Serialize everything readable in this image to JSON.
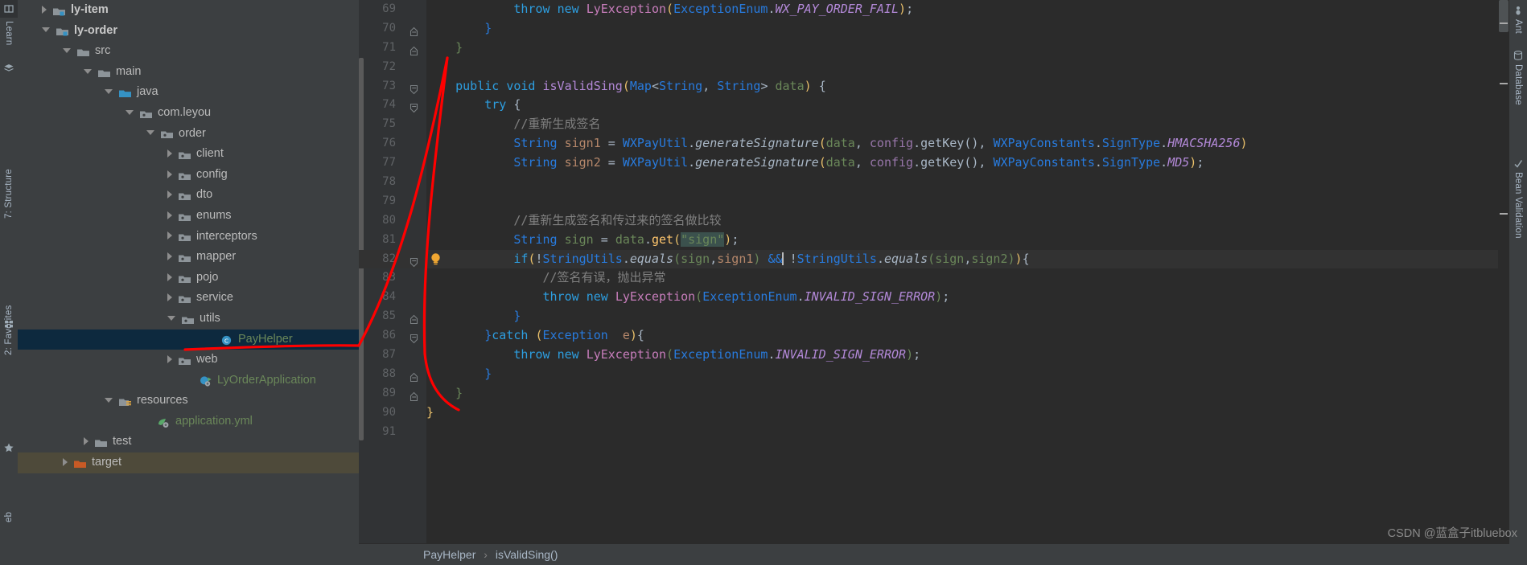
{
  "app": {
    "theme_bg": "#3c3f41",
    "editor_bg": "#2b2b2b",
    "selection_bg": "#0d293e",
    "annotation_color": "#ff0000"
  },
  "left_stripe": {
    "items": [
      {
        "label": "Learn",
        "icon": "learn-icon"
      },
      {
        "label": "7: Structure",
        "icon": "structure-icon"
      },
      {
        "label": "2: Favorites",
        "icon": "favorites-star-icon"
      }
    ]
  },
  "right_stripe": {
    "items": [
      {
        "label": "Ant",
        "icon": "ant-icon"
      },
      {
        "label": "Database",
        "icon": "database-icon"
      },
      {
        "label": "Bean Validation",
        "icon": "bean-validation-icon"
      }
    ]
  },
  "project_tree": {
    "rows": [
      {
        "label": "ly-item",
        "indent": 1,
        "arrow": "closed",
        "icon": "module-folder-icon",
        "style": "module"
      },
      {
        "label": "ly-order",
        "indent": 1,
        "arrow": "open",
        "icon": "module-folder-icon",
        "style": "module"
      },
      {
        "label": "src",
        "indent": 2,
        "arrow": "open",
        "icon": "folder-icon",
        "style": "normal"
      },
      {
        "label": "main",
        "indent": 3,
        "arrow": "open",
        "icon": "folder-icon",
        "style": "normal"
      },
      {
        "label": "java",
        "indent": 4,
        "arrow": "open",
        "icon": "source-folder-icon",
        "style": "normal"
      },
      {
        "label": "com.leyou",
        "indent": 5,
        "arrow": "open",
        "icon": "package-icon",
        "style": "normal"
      },
      {
        "label": "order",
        "indent": 6,
        "arrow": "open",
        "icon": "package-icon",
        "style": "normal"
      },
      {
        "label": "client",
        "indent": 7,
        "arrow": "closed",
        "icon": "package-icon",
        "style": "normal"
      },
      {
        "label": "config",
        "indent": 7,
        "arrow": "closed",
        "icon": "package-icon",
        "style": "normal"
      },
      {
        "label": "dto",
        "indent": 7,
        "arrow": "closed",
        "icon": "package-icon",
        "style": "normal"
      },
      {
        "label": "enums",
        "indent": 7,
        "arrow": "closed",
        "icon": "package-icon",
        "style": "normal"
      },
      {
        "label": "interceptors",
        "indent": 7,
        "arrow": "closed",
        "icon": "package-icon",
        "style": "normal"
      },
      {
        "label": "mapper",
        "indent": 7,
        "arrow": "closed",
        "icon": "package-icon",
        "style": "normal"
      },
      {
        "label": "pojo",
        "indent": 7,
        "arrow": "closed",
        "icon": "package-icon",
        "style": "normal"
      },
      {
        "label": "service",
        "indent": 7,
        "arrow": "closed",
        "icon": "package-icon",
        "style": "normal"
      },
      {
        "label": "utils",
        "indent": 7,
        "arrow": "open",
        "icon": "package-icon",
        "style": "normal"
      },
      {
        "label": "PayHelper",
        "indent": 9,
        "arrow": "none",
        "icon": "java-class-icon",
        "style": "green",
        "selected": true
      },
      {
        "label": "web",
        "indent": 7,
        "arrow": "closed",
        "icon": "package-icon",
        "style": "normal"
      },
      {
        "label": "LyOrderApplication",
        "indent": 8,
        "arrow": "none",
        "icon": "spring-class-icon",
        "style": "green"
      },
      {
        "label": "resources",
        "indent": 4,
        "arrow": "open",
        "icon": "resources-folder-icon",
        "style": "normal"
      },
      {
        "label": "application.yml",
        "indent": 6,
        "arrow": "none",
        "icon": "spring-yml-icon",
        "style": "green"
      },
      {
        "label": "test",
        "indent": 3,
        "arrow": "closed",
        "icon": "folder-icon",
        "style": "normal"
      },
      {
        "label": "target",
        "indent": 2,
        "arrow": "closed",
        "icon": "excluded-folder-icon",
        "style": "normal",
        "excluded": true
      }
    ]
  },
  "editor": {
    "first_line_number": 69,
    "current_line": 82,
    "lines": [
      {
        "n": 69,
        "fold": "none",
        "tokens": [
          {
            "t": "            ",
            "c": "plain"
          },
          {
            "t": "throw",
            "c": "kwb"
          },
          {
            "t": " ",
            "c": "plain"
          },
          {
            "t": "new",
            "c": "kwb"
          },
          {
            "t": " ",
            "c": "plain"
          },
          {
            "t": "LyException",
            "c": "magenta"
          },
          {
            "t": "(",
            "c": "br1"
          },
          {
            "t": "ExceptionEnum",
            "c": "blu"
          },
          {
            "t": ".",
            "c": "plain"
          },
          {
            "t": "WX_PAY_ORDER_FAIL",
            "c": "stat"
          },
          {
            "t": ")",
            "c": "br1"
          },
          {
            "t": ";",
            "c": "plain"
          }
        ]
      },
      {
        "n": 70,
        "fold": "end",
        "tokens": [
          {
            "t": "        ",
            "c": "plain"
          },
          {
            "t": "}",
            "c": "blu"
          }
        ]
      },
      {
        "n": 71,
        "fold": "end",
        "tokens": [
          {
            "t": "    ",
            "c": "plain"
          },
          {
            "t": "}",
            "c": "grn"
          }
        ]
      },
      {
        "n": 72,
        "fold": "none",
        "tokens": []
      },
      {
        "n": 73,
        "fold": "start",
        "tokens": [
          {
            "t": "    ",
            "c": "plain"
          },
          {
            "t": "public",
            "c": "kwb"
          },
          {
            "t": " ",
            "c": "plain"
          },
          {
            "t": "void",
            "c": "kwb"
          },
          {
            "t": " ",
            "c": "plain"
          },
          {
            "t": "isValidSing",
            "c": "mthdecl"
          },
          {
            "t": "(",
            "c": "br1"
          },
          {
            "t": "Map",
            "c": "blu"
          },
          {
            "t": "<",
            "c": "plain"
          },
          {
            "t": "String",
            "c": "blu"
          },
          {
            "t": ", ",
            "c": "plain"
          },
          {
            "t": "String",
            "c": "blu"
          },
          {
            "t": "> ",
            "c": "plain"
          },
          {
            "t": "data",
            "c": "grn"
          },
          {
            "t": ")",
            "c": "br1"
          },
          {
            "t": " ",
            "c": "plain"
          },
          {
            "t": "{",
            "c": "plain"
          }
        ]
      },
      {
        "n": 74,
        "fold": "start",
        "tokens": [
          {
            "t": "        ",
            "c": "plain"
          },
          {
            "t": "try",
            "c": "kwb"
          },
          {
            "t": " ",
            "c": "plain"
          },
          {
            "t": "{",
            "c": "plain"
          }
        ]
      },
      {
        "n": 75,
        "fold": "none",
        "tokens": [
          {
            "t": "            ",
            "c": "plain"
          },
          {
            "t": "//重新生成签名",
            "c": "cmt"
          }
        ]
      },
      {
        "n": 76,
        "fold": "none",
        "tokens": [
          {
            "t": "            ",
            "c": "plain"
          },
          {
            "t": "String",
            "c": "blu"
          },
          {
            "t": " ",
            "c": "plain"
          },
          {
            "t": "sign1",
            "c": "param"
          },
          {
            "t": " ",
            "c": "plain"
          },
          {
            "t": "=",
            "c": "plain"
          },
          {
            "t": " ",
            "c": "plain"
          },
          {
            "t": "WXPayUtil",
            "c": "blu"
          },
          {
            "t": ".",
            "c": "plain"
          },
          {
            "t": "generateSignature",
            "c": "statm"
          },
          {
            "t": "(",
            "c": "br1"
          },
          {
            "t": "data",
            "c": "grn"
          },
          {
            "t": ", ",
            "c": "plain"
          },
          {
            "t": "config",
            "c": "field"
          },
          {
            "t": ".",
            "c": "plain"
          },
          {
            "t": "getKey",
            "c": "plain"
          },
          {
            "t": "()",
            "c": "plain"
          },
          {
            "t": ", ",
            "c": "plain"
          },
          {
            "t": "WXPayConstants",
            "c": "blu"
          },
          {
            "t": ".",
            "c": "plain"
          },
          {
            "t": "SignType",
            "c": "blu"
          },
          {
            "t": ".",
            "c": "plain"
          },
          {
            "t": "HMACSHA256",
            "c": "stat"
          },
          {
            "t": ")",
            "c": "br1"
          }
        ]
      },
      {
        "n": 77,
        "fold": "none",
        "tokens": [
          {
            "t": "            ",
            "c": "plain"
          },
          {
            "t": "String",
            "c": "blu"
          },
          {
            "t": " ",
            "c": "plain"
          },
          {
            "t": "sign2",
            "c": "param"
          },
          {
            "t": " ",
            "c": "plain"
          },
          {
            "t": "=",
            "c": "plain"
          },
          {
            "t": " ",
            "c": "plain"
          },
          {
            "t": "WXPayUtil",
            "c": "blu"
          },
          {
            "t": ".",
            "c": "plain"
          },
          {
            "t": "generateSignature",
            "c": "statm"
          },
          {
            "t": "(",
            "c": "br1"
          },
          {
            "t": "data",
            "c": "grn"
          },
          {
            "t": ", ",
            "c": "plain"
          },
          {
            "t": "config",
            "c": "field"
          },
          {
            "t": ".",
            "c": "plain"
          },
          {
            "t": "getKey",
            "c": "plain"
          },
          {
            "t": "()",
            "c": "plain"
          },
          {
            "t": ", ",
            "c": "plain"
          },
          {
            "t": "WXPayConstants",
            "c": "blu"
          },
          {
            "t": ".",
            "c": "plain"
          },
          {
            "t": "SignType",
            "c": "blu"
          },
          {
            "t": ".",
            "c": "plain"
          },
          {
            "t": "MD5",
            "c": "stat"
          },
          {
            "t": ")",
            "c": "br1"
          },
          {
            "t": ";",
            "c": "plain"
          }
        ]
      },
      {
        "n": 78,
        "fold": "none",
        "tokens": []
      },
      {
        "n": 79,
        "fold": "none",
        "tokens": []
      },
      {
        "n": 80,
        "fold": "none",
        "tokens": [
          {
            "t": "            ",
            "c": "plain"
          },
          {
            "t": "//重新生成签名和传过来的签名做比较",
            "c": "cmt"
          }
        ]
      },
      {
        "n": 81,
        "fold": "none",
        "tokens": [
          {
            "t": "            ",
            "c": "plain"
          },
          {
            "t": "String",
            "c": "blu"
          },
          {
            "t": " ",
            "c": "plain"
          },
          {
            "t": "sign",
            "c": "grn"
          },
          {
            "t": " ",
            "c": "plain"
          },
          {
            "t": "=",
            "c": "plain"
          },
          {
            "t": " ",
            "c": "plain"
          },
          {
            "t": "data",
            "c": "grn"
          },
          {
            "t": ".",
            "c": "plain"
          },
          {
            "t": "get",
            "c": "mth"
          },
          {
            "t": "(",
            "c": "br1"
          },
          {
            "t": "\"sign\"",
            "c": "str-hl"
          },
          {
            "t": ")",
            "c": "br1"
          },
          {
            "t": ";",
            "c": "plain"
          }
        ]
      },
      {
        "n": 82,
        "fold": "start",
        "bulb": true,
        "current": true,
        "tokens": [
          {
            "t": "            ",
            "c": "plain"
          },
          {
            "t": "if",
            "c": "kwb"
          },
          {
            "t": "(",
            "c": "br1"
          },
          {
            "t": "!",
            "c": "plain"
          },
          {
            "t": "StringUtils",
            "c": "blu"
          },
          {
            "t": ".",
            "c": "plain"
          },
          {
            "t": "equals",
            "c": "statm"
          },
          {
            "t": "(",
            "c": "grn-br"
          },
          {
            "t": "sign",
            "c": "grn"
          },
          {
            "t": ",",
            "c": "plain"
          },
          {
            "t": "sign1",
            "c": "param"
          },
          {
            "t": ")",
            "c": "grn-br"
          },
          {
            "t": " ",
            "c": "plain"
          },
          {
            "t": "&&",
            "c": "blu",
            "caret_after": true
          },
          {
            "t": " ",
            "c": "plain"
          },
          {
            "t": "!",
            "c": "plain"
          },
          {
            "t": "StringUtils",
            "c": "blu"
          },
          {
            "t": ".",
            "c": "plain"
          },
          {
            "t": "equals",
            "c": "statm"
          },
          {
            "t": "(",
            "c": "grn-br"
          },
          {
            "t": "sign",
            "c": "grn"
          },
          {
            "t": ",",
            "c": "plain"
          },
          {
            "t": "sign2",
            "c": "grn"
          },
          {
            "t": ")",
            "c": "grn-br"
          },
          {
            "t": ")",
            "c": "br1"
          },
          {
            "t": "{",
            "c": "plain"
          }
        ]
      },
      {
        "n": 83,
        "fold": "none",
        "tokens": [
          {
            "t": "                ",
            "c": "plain"
          },
          {
            "t": "//签名有误，抛出异常",
            "c": "cmt"
          }
        ]
      },
      {
        "n": 84,
        "fold": "none",
        "tokens": [
          {
            "t": "                ",
            "c": "plain"
          },
          {
            "t": "throw",
            "c": "kwb"
          },
          {
            "t": " ",
            "c": "plain"
          },
          {
            "t": "new",
            "c": "kwb"
          },
          {
            "t": " ",
            "c": "plain"
          },
          {
            "t": "LyException",
            "c": "magenta"
          },
          {
            "t": "(",
            "c": "grn-br"
          },
          {
            "t": "ExceptionEnum",
            "c": "blu"
          },
          {
            "t": ".",
            "c": "plain"
          },
          {
            "t": "INVALID_SIGN_ERROR",
            "c": "stat"
          },
          {
            "t": ")",
            "c": "grn-br"
          },
          {
            "t": ";",
            "c": "plain"
          }
        ]
      },
      {
        "n": 85,
        "fold": "end",
        "tokens": [
          {
            "t": "            ",
            "c": "plain"
          },
          {
            "t": "}",
            "c": "blu"
          }
        ]
      },
      {
        "n": 86,
        "fold": "start",
        "tokens": [
          {
            "t": "        ",
            "c": "plain"
          },
          {
            "t": "}",
            "c": "blu"
          },
          {
            "t": "catch",
            "c": "kwb"
          },
          {
            "t": " ",
            "c": "plain"
          },
          {
            "t": "(",
            "c": "br1"
          },
          {
            "t": "Exception",
            "c": "blu"
          },
          {
            "t": "  ",
            "c": "plain"
          },
          {
            "t": "e",
            "c": "param"
          },
          {
            "t": ")",
            "c": "br1"
          },
          {
            "t": "{",
            "c": "plain"
          }
        ]
      },
      {
        "n": 87,
        "fold": "none",
        "tokens": [
          {
            "t": "            ",
            "c": "plain"
          },
          {
            "t": "throw",
            "c": "kwb"
          },
          {
            "t": " ",
            "c": "plain"
          },
          {
            "t": "new",
            "c": "kwb"
          },
          {
            "t": " ",
            "c": "plain"
          },
          {
            "t": "LyException",
            "c": "magenta"
          },
          {
            "t": "(",
            "c": "grn-br"
          },
          {
            "t": "ExceptionEnum",
            "c": "blu"
          },
          {
            "t": ".",
            "c": "plain"
          },
          {
            "t": "INVALID_SIGN_ERROR",
            "c": "stat"
          },
          {
            "t": ")",
            "c": "grn-br"
          },
          {
            "t": ";",
            "c": "plain"
          }
        ]
      },
      {
        "n": 88,
        "fold": "end",
        "tokens": [
          {
            "t": "        ",
            "c": "plain"
          },
          {
            "t": "}",
            "c": "blu"
          }
        ]
      },
      {
        "n": 89,
        "fold": "end",
        "tokens": [
          {
            "t": "    ",
            "c": "plain"
          },
          {
            "t": "}",
            "c": "grn"
          }
        ]
      },
      {
        "n": 90,
        "fold": "none",
        "tokens": [
          {
            "t": "}",
            "c": "br1"
          }
        ]
      },
      {
        "n": 91,
        "fold": "none",
        "tokens": []
      }
    ]
  },
  "breadcrumb": {
    "class_name": "PayHelper",
    "separator": "›",
    "method_name": "isValidSing()"
  },
  "watermark": {
    "text": "CSDN @蓝盒子itbluebox"
  }
}
